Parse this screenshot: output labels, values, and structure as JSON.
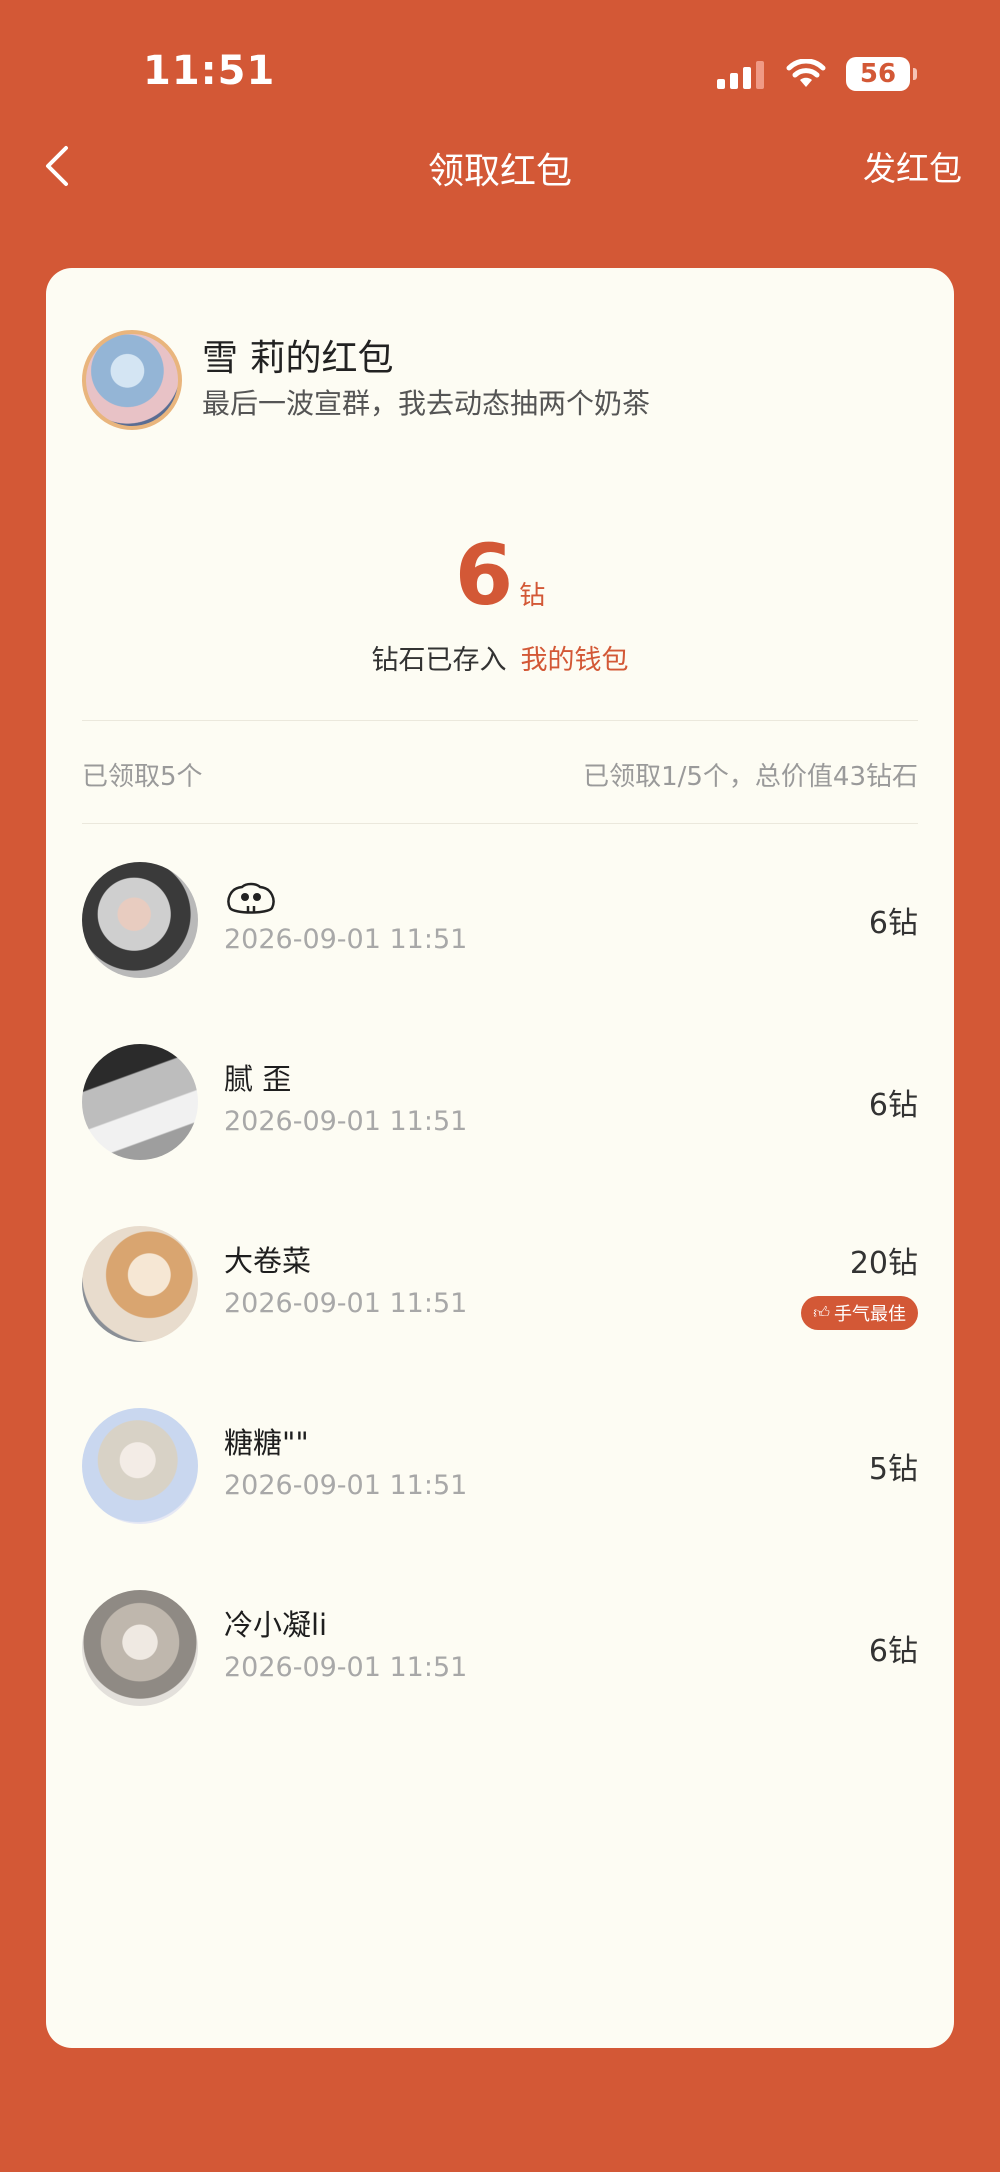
{
  "status_bar": {
    "time": "11:51",
    "battery": "56",
    "icons": [
      "cellular-signal-icon",
      "wifi-icon",
      "battery-icon"
    ]
  },
  "nav": {
    "back_icon": "chevron-left-icon",
    "title": "领取红包",
    "action": "发红包"
  },
  "sender": {
    "title": "雪 莉的红包",
    "message": "最后一波宣群，我去动态抽两个奶茶"
  },
  "amount": {
    "value": "6",
    "unit": "钻"
  },
  "wallet": {
    "text": "钻石已存入",
    "link": "我的钱包"
  },
  "summary": {
    "left": "已领取5个",
    "right": "已领取1/5个，总价值43钻石"
  },
  "records": [
    {
      "name": "",
      "name_icon": "cartoon-face-icon",
      "time": "2026-09-01 11:51",
      "amount": "6钻"
    },
    {
      "name": "腻 歪",
      "time": "2026-09-01 11:51",
      "amount": "6钻"
    },
    {
      "name": "大卷菜",
      "time": "2026-09-01 11:51",
      "amount": "20钻",
      "badge": "手气最佳",
      "badge_icon": "thumbs-up-icon"
    },
    {
      "name": "糖糖\"\"",
      "time": "2026-09-01 11:51",
      "amount": "5钻"
    },
    {
      "name": "冷小凝li",
      "time": "2026-09-01 11:51",
      "amount": "6钻"
    }
  ],
  "colors": {
    "brand": "#d35836",
    "card": "#fdfcf3",
    "text_primary": "#1e1e1e",
    "text_secondary": "#a8a8a8"
  }
}
